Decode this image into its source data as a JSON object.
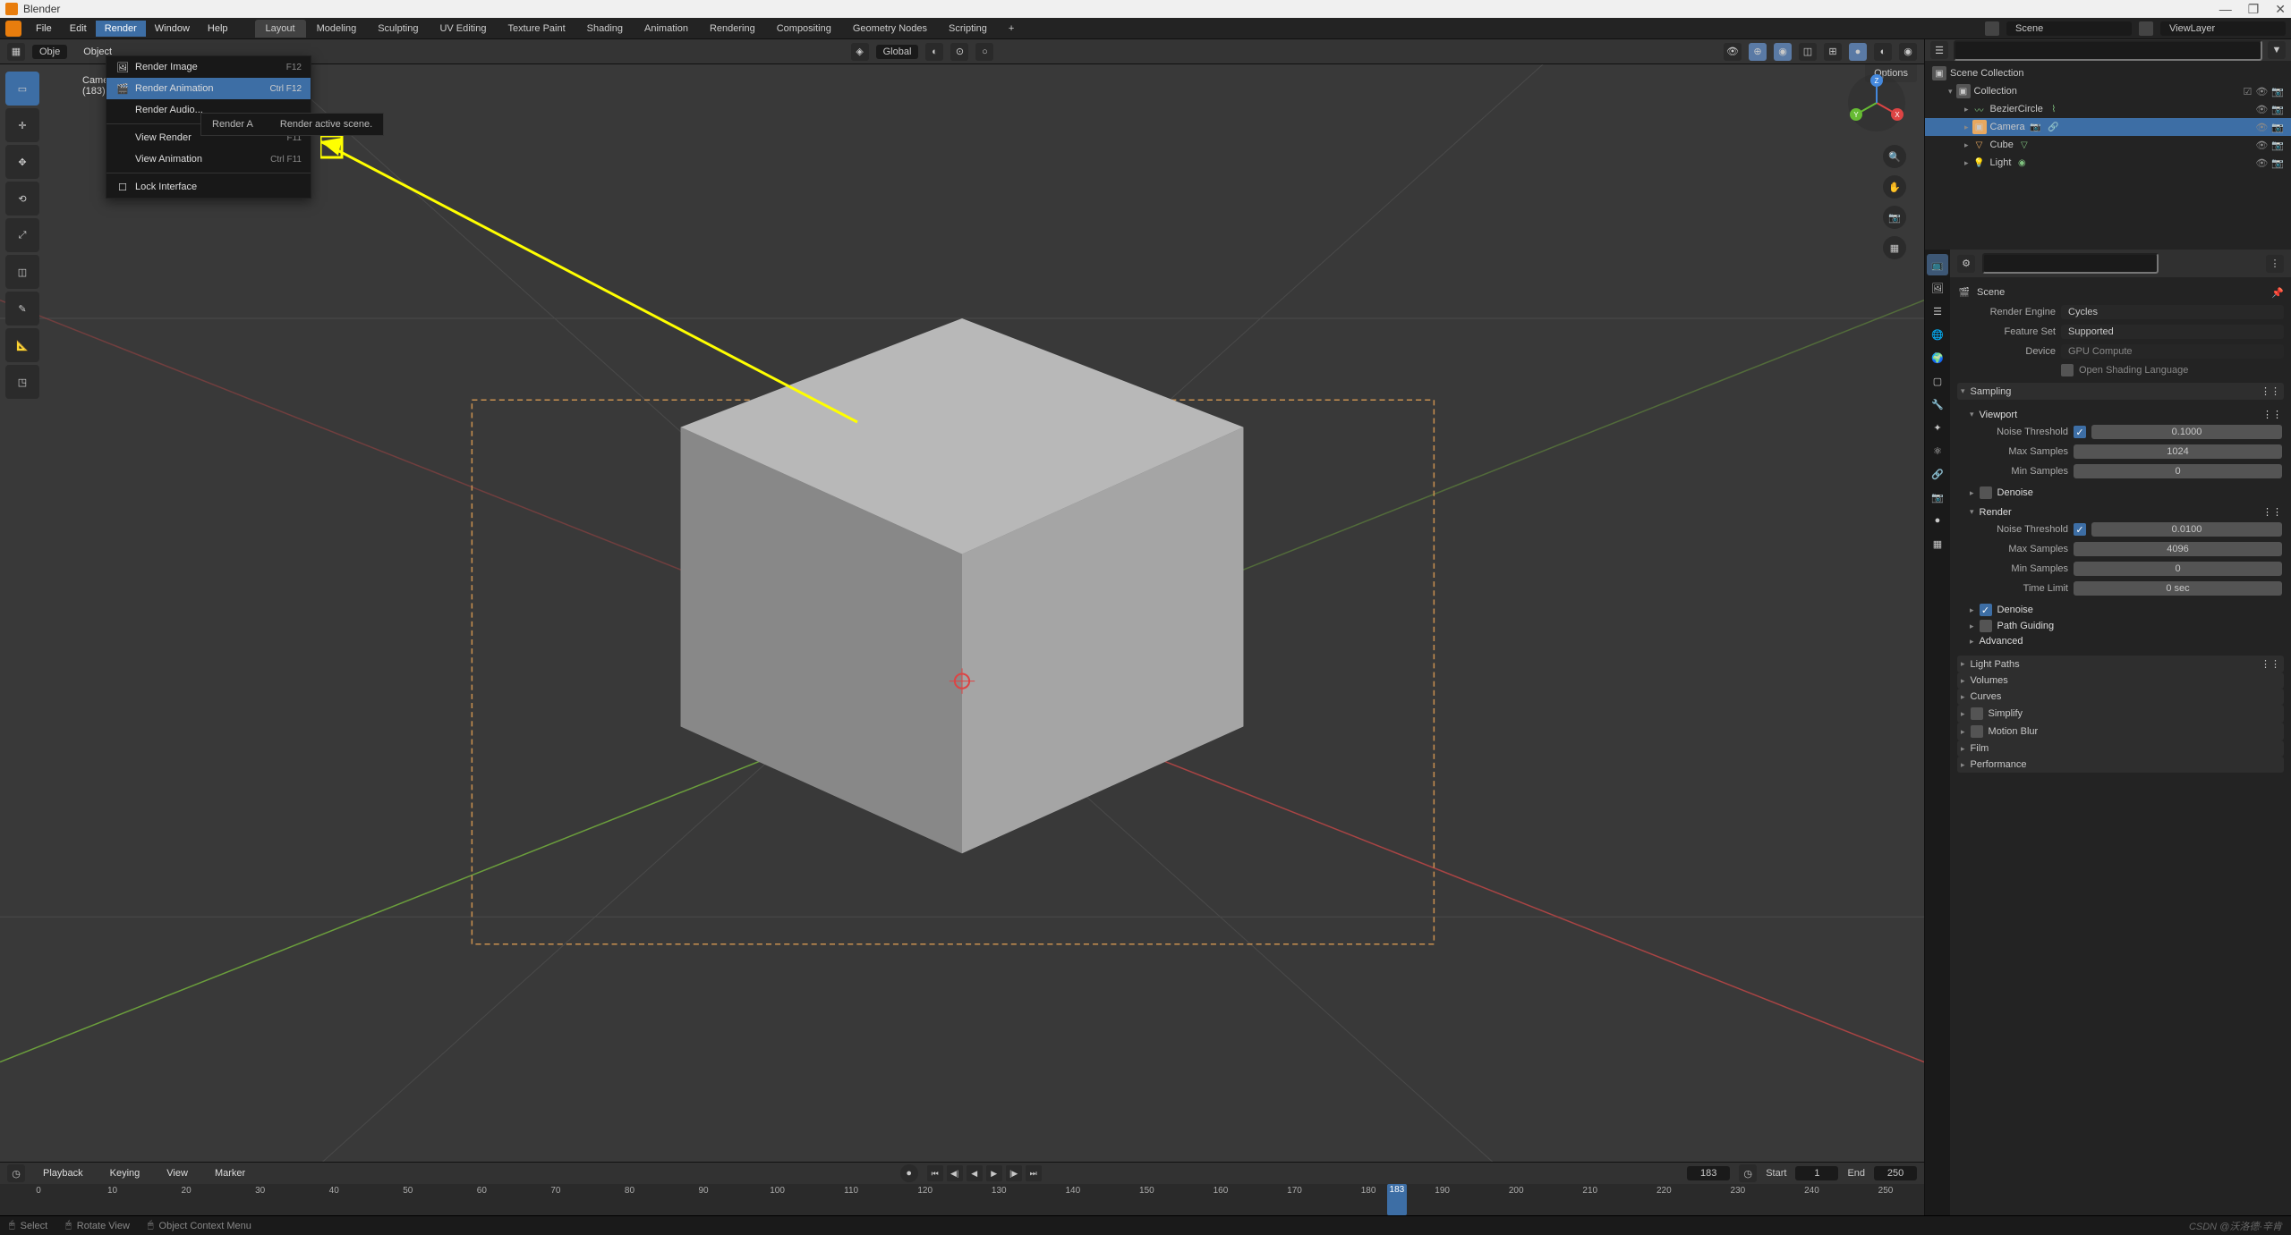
{
  "app": {
    "title": "Blender"
  },
  "titlebar": {
    "minimize": "—",
    "maximize": "❐",
    "close": "✕"
  },
  "menubar": {
    "items": [
      "File",
      "Edit",
      "Render",
      "Window",
      "Help"
    ],
    "workspaces": [
      "Layout",
      "Modeling",
      "Sculpting",
      "UV Editing",
      "Texture Paint",
      "Shading",
      "Animation",
      "Rendering",
      "Compositing",
      "Geometry Nodes",
      "Scripting"
    ],
    "add_tab": "+",
    "scene_label": "Scene",
    "viewlayer_label": "ViewLayer"
  },
  "render_menu": {
    "items": [
      {
        "label": "Render Image",
        "shortcut": "F12",
        "icon": "image"
      },
      {
        "label": "Render Animation",
        "shortcut": "Ctrl F12",
        "icon": "clapper",
        "highlighted": true
      },
      {
        "label": "Render Audio...",
        "shortcut": "",
        "icon": ""
      },
      {
        "label": "View Render",
        "shortcut": "F11",
        "icon": ""
      },
      {
        "label": "View Animation",
        "shortcut": "Ctrl F11",
        "icon": ""
      },
      {
        "label": "Lock Interface",
        "shortcut": "",
        "icon": "checkbox"
      }
    ],
    "tooltip_left": "Render A",
    "tooltip": "Render active scene."
  },
  "viewport_header": {
    "object_mode": "Obje",
    "view_menu": "Object",
    "orientation": "Global",
    "options": "Options"
  },
  "viewport_info": {
    "object": "Came",
    "frame": "(183)"
  },
  "outliner": {
    "search_placeholder": "",
    "scene": "Scene Collection",
    "collection": "Collection",
    "items": [
      {
        "name": "BezierCircle",
        "icon": "curve",
        "color": "#7fc17f"
      },
      {
        "name": "Camera",
        "icon": "camera",
        "color": "#e8a85f",
        "selected": true
      },
      {
        "name": "Cube",
        "icon": "mesh",
        "color": "#e8a85f"
      },
      {
        "name": "Light",
        "icon": "light",
        "color": "#7fc17f"
      }
    ]
  },
  "properties": {
    "breadcrumb": "Scene",
    "render_engine_label": "Render Engine",
    "render_engine": "Cycles",
    "feature_set_label": "Feature Set",
    "feature_set": "Supported",
    "device_label": "Device",
    "device": "GPU Compute",
    "osl_label": "Open Shading Language",
    "sampling": {
      "title": "Sampling",
      "viewport": {
        "title": "Viewport",
        "noise_threshold_label": "Noise Threshold",
        "noise_threshold": "0.1000",
        "max_samples_label": "Max Samples",
        "max_samples": "1024",
        "min_samples_label": "Min Samples",
        "min_samples": "0"
      },
      "denoise_vp": "Denoise",
      "render": {
        "title": "Render",
        "noise_threshold_label": "Noise Threshold",
        "noise_threshold": "0.0100",
        "max_samples_label": "Max Samples",
        "max_samples": "4096",
        "min_samples_label": "Min Samples",
        "min_samples": "0",
        "time_limit_label": "Time Limit",
        "time_limit": "0 sec"
      },
      "denoise_r": "Denoise",
      "path_guiding": "Path Guiding",
      "advanced": "Advanced"
    },
    "sections": [
      "Light Paths",
      "Volumes",
      "Curves",
      "Simplify",
      "Motion Blur",
      "Film",
      "Performance"
    ]
  },
  "timeline": {
    "playback": "Playback",
    "keying": "Keying",
    "view": "View",
    "marker": "Marker",
    "current_frame": "183",
    "start_label": "Start",
    "start": "1",
    "end_label": "End",
    "end": "250",
    "ticks": [
      "0",
      "10",
      "20",
      "30",
      "40",
      "50",
      "60",
      "70",
      "80",
      "90",
      "100",
      "110",
      "120",
      "130",
      "140",
      "150",
      "160",
      "170",
      "180",
      "190",
      "200",
      "210",
      "220",
      "230",
      "240",
      "250"
    ]
  },
  "statusbar": {
    "select": "Select",
    "rotate": "Rotate View",
    "context": "Object Context Menu"
  },
  "watermark": "CSDN @沃洛德·辛肯"
}
